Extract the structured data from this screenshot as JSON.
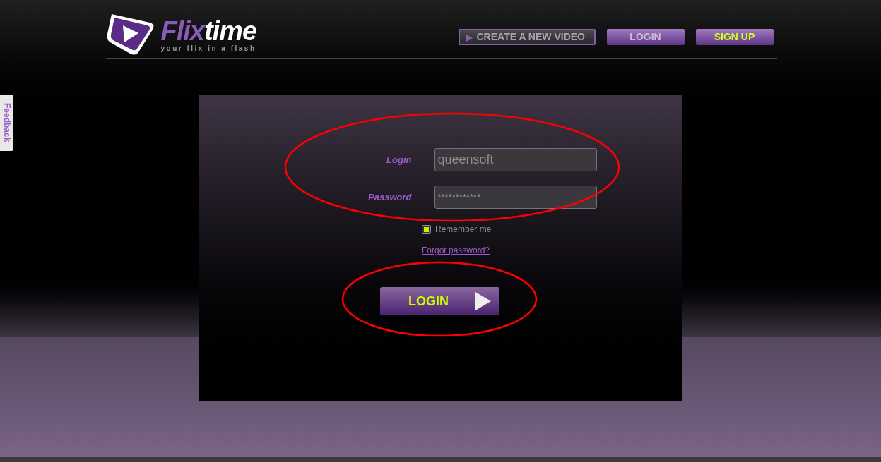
{
  "header": {
    "logo": {
      "wordmark": [
        {
          "text": "Flix",
          "color": "#8a5bb8"
        },
        {
          "text": "time",
          "color": "#ffffff"
        }
      ],
      "tagline": "your flix in a flash"
    },
    "nav": [
      {
        "label": "CREATE A NEW VIDEO",
        "kind": "outline"
      },
      {
        "label": "LOGIN",
        "kind": "plain"
      },
      {
        "label": "SIGN UP",
        "kind": "accent"
      }
    ]
  },
  "feedback_tab": {
    "label": "Feedback"
  },
  "login_form": {
    "fields": [
      {
        "label": "Login",
        "value": "queensoft",
        "kind": "text"
      },
      {
        "label": "Password",
        "value": "************",
        "kind": "password"
      }
    ],
    "remember": {
      "label": "Remember me",
      "checked": true
    },
    "forgot_link": "Forgot password?",
    "submit": "LOGIN"
  }
}
